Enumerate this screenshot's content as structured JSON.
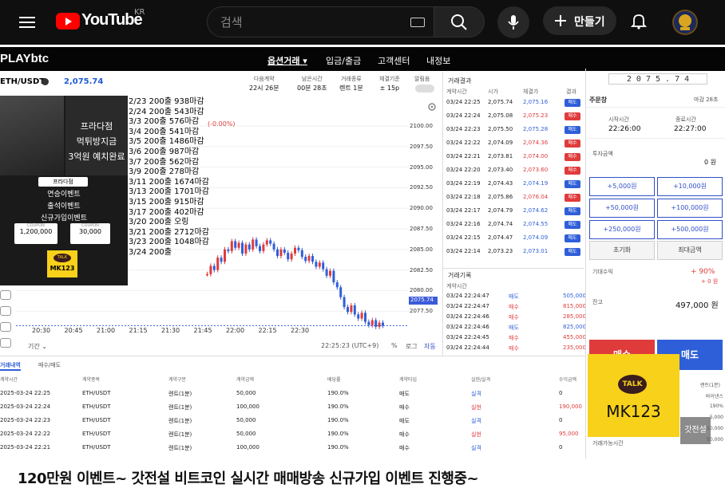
{
  "youtube": {
    "logo_text": "YouTube",
    "country": "KR",
    "search_placeholder": "검색",
    "create_label": "만들기"
  },
  "video": {
    "title": "120만원 이벤트~ 갓전설 비트코인 실시간 매매방송 신규가입 이벤트 진행중~",
    "watermark": "갓전설"
  },
  "playbtc": {
    "logo": "PLAYbtc",
    "nav": [
      "옵션거래 ▾",
      "입금/출금",
      "고객센터",
      "내정보"
    ],
    "pair": "ETH/USDT",
    "price": "2,075.74",
    "option_headers": [
      {
        "label": "다음계약",
        "value": "22시 26분"
      },
      {
        "label": "남은시간",
        "value": "00분 28초"
      },
      {
        "label": "거래종류",
        "value": "렌트 1분"
      },
      {
        "label": "체결기준",
        "value": "± 15p"
      },
      {
        "label": "알림음",
        "value": ""
      }
    ],
    "change": "(-0.00%)",
    "chart_time": "22:25:23 (UTC+9)",
    "chart_controls": [
      "기간 ⌄",
      "%",
      "로그",
      "자동"
    ]
  },
  "ad": {
    "lines": [
      "프라다점",
      "먹튀방지금",
      "3억원 예치완료"
    ],
    "brand": "프라다점",
    "events": [
      "연승이벤트",
      "출석이벤트",
      "신규가입이벤트"
    ],
    "coupons": [
      "1,200,000",
      "30,000"
    ],
    "coupon_label": "COUPON",
    "tile_top": "TALK",
    "tile_bottom": "MK123"
  },
  "notice_lines": [
    "2/23 200출 938마감",
    "2/24 200출 543마감",
    "3/3 200출 576마감",
    "3/4 200출 541마감",
    "3/5 200출 1486마감",
    "3/6 200출 987마감",
    "3/7 200출 562마감",
    "3/9 200출 278마감",
    "3/11 200출 1674마감",
    "3/13 200출 1701마감",
    "3/15 200출 915마감",
    "3/17 200출 402마감",
    "3/20 200출 오링",
    "3/21 200출 2712마감",
    "3/23 200출 1048마감",
    "3/24 200출"
  ],
  "chart_data": {
    "type": "candlestick",
    "y_ticks": [
      "2100.00",
      "2097.50",
      "2095.00",
      "2092.50",
      "2090.00",
      "2087.50",
      "2085.00",
      "2082.50",
      "2080.00",
      "2077.50"
    ],
    "x_ticks": [
      "20:30",
      "20:45",
      "21:00",
      "21:15",
      "21:30",
      "21:45",
      "22:00",
      "22:15",
      "22:30"
    ],
    "current_price": "2075.74",
    "ylim": [
      2075,
      2101
    ]
  },
  "trade_results": {
    "title": "거래결과",
    "headers": [
      "계약시간",
      "시가",
      "체결가",
      "결과"
    ],
    "rows": [
      [
        "03/24 22:25",
        "2,075.74",
        "2,075.16",
        "매도",
        "down"
      ],
      [
        "03/24 22:24",
        "2,075.08",
        "2,075.23",
        "매수",
        "up"
      ],
      [
        "03/24 22:23",
        "2,075.50",
        "2,075.28",
        "매도",
        "down"
      ],
      [
        "03/24 22:22",
        "2,074.09",
        "2,074.36",
        "매수",
        "up"
      ],
      [
        "03/24 22:21",
        "2,073.81",
        "2,074.00",
        "매수",
        "up"
      ],
      [
        "03/24 22:20",
        "2,073.40",
        "2,073.60",
        "매수",
        "up"
      ],
      [
        "03/24 22:19",
        "2,074.43",
        "2,074.19",
        "매도",
        "down"
      ],
      [
        "03/24 22:18",
        "2,075.86",
        "2,076.04",
        "매수",
        "up"
      ],
      [
        "03/24 22:17",
        "2,074.79",
        "2,074.62",
        "매도",
        "down"
      ],
      [
        "03/24 22:16",
        "2,074.74",
        "2,074.55",
        "매도",
        "down"
      ],
      [
        "03/24 22:15",
        "2,074.47",
        "2,074.09",
        "매도",
        "down"
      ],
      [
        "03/24 22:14",
        "2,073.23",
        "2,073.01",
        "매도",
        "down"
      ]
    ]
  },
  "trade_log": {
    "title": "거래기록",
    "headers": [
      "계약시간",
      "",
      ""
    ],
    "rows": [
      [
        "03/24 22:24:47",
        "매도",
        "505,000",
        "down"
      ],
      [
        "03/24 22:24:47",
        "매수",
        "815,000",
        "up"
      ],
      [
        "03/24 22:24:46",
        "매수",
        "285,000",
        "up"
      ],
      [
        "03/24 22:24:46",
        "매도",
        "825,000",
        "down"
      ],
      [
        "03/24 22:24:45",
        "매수",
        "455,000",
        "up"
      ],
      [
        "03/24 22:24:44",
        "매수",
        "235,000",
        "up"
      ]
    ]
  },
  "order": {
    "clock": "2 0 7 5 . 7 4",
    "title": "주문창",
    "remain": "마감 28초",
    "start_label": "시작시간",
    "start": "22:26:00",
    "end_label": "종료시간",
    "end": "22:27:00",
    "invest_label": "투자금액",
    "invest": "0 원",
    "amounts": [
      "+5,000원",
      "+10,000원",
      "+50,000원",
      "+100,000원",
      "+250,000원",
      "+500,000원"
    ],
    "reset": "초기화",
    "max": "최대금액",
    "profit_label": "기대수익",
    "profit_pct": "+ 90%",
    "profit_amt": "+ 0 원",
    "balance_label": "잔고",
    "balance": "497,000 원",
    "buy": "매수",
    "sell": "매도",
    "side_labels": [
      "렌트(1분)",
      "바이낸스",
      "190%",
      "5,000",
      "10,000",
      "50,000"
    ],
    "avail": "거래가능시간"
  },
  "history": {
    "tabs": [
      "거래내역",
      "매수/매도"
    ],
    "headers": [
      "계약시간",
      "계약종목",
      "계약구분",
      "계약금액",
      "배당률",
      "계약타입",
      "실현/실격",
      "수익금액"
    ],
    "rows": [
      [
        "2025-03-24 22:25",
        "ETH/USDT",
        "렌트(1분)",
        "50,000",
        "190.0%",
        "매도",
        "실격",
        "0"
      ],
      [
        "2025-03-24 22:24",
        "ETH/USDT",
        "렌트(1분)",
        "100,000",
        "190.0%",
        "매수",
        "실현",
        "190,000"
      ],
      [
        "2025-03-24 22:23",
        "ETH/USDT",
        "렌트(1분)",
        "50,000",
        "190.0%",
        "매도",
        "실격",
        "0"
      ],
      [
        "2025-03-24 22:22",
        "ETH/USDT",
        "렌트(1분)",
        "50,000",
        "190.0%",
        "매수",
        "실현",
        "95,000"
      ],
      [
        "2025-03-24 22:21",
        "ETH/USDT",
        "렌트(1분)",
        "100,000",
        "190.0%",
        "매수",
        "실격",
        "0"
      ]
    ]
  },
  "colors": {
    "up": "#e03b3b",
    "down": "#2f5fd8",
    "accent": "#3050c8",
    "kakao": "#f7d11a"
  }
}
